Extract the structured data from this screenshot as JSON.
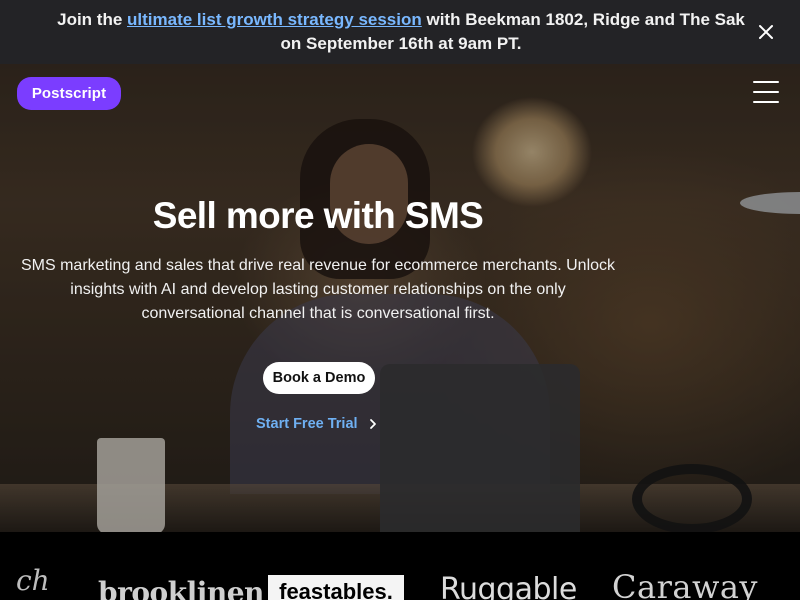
{
  "banner": {
    "prefix": "Join the ",
    "link_text": "ultimate list growth strategy session",
    "suffix": " with Beekman 1802, Ridge and The Sak on September 16th at 9am PT.",
    "close_icon": "close-icon"
  },
  "header": {
    "logo_text": "Postscript",
    "menu_icon": "hamburger-menu-icon"
  },
  "hero": {
    "title": "Sell more with SMS",
    "description": "SMS marketing and sales that drive real revenue for ecommerce merchants. Unlock insights with AI and develop lasting customer relationships on the only conversational channel that is conversational first.",
    "primary_cta": "Book a Demo",
    "secondary_cta": "Start Free Trial"
  },
  "logos": {
    "partial": "ch",
    "brooklinen": "brooklinen",
    "feastables": "feastables.",
    "ruggable": "Ruggable",
    "caraway": "Caraway"
  },
  "colors": {
    "banner_bg": "#232326",
    "banner_link": "#79b8ff",
    "brand_purple": "#7b3dff",
    "cta_link": "#6fb0f2",
    "logos_bg": "#000000"
  }
}
